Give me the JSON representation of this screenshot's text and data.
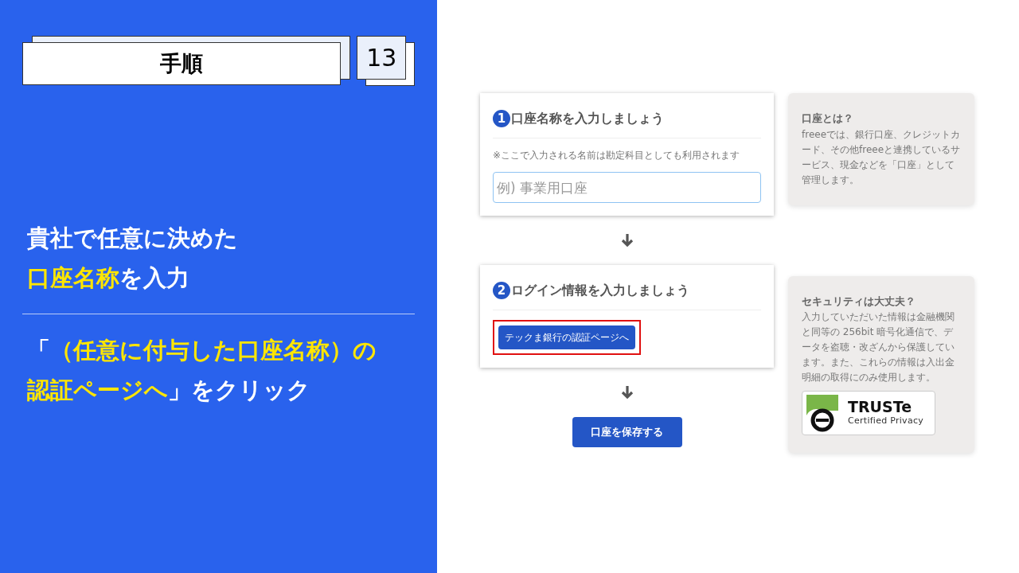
{
  "header": {
    "title": "手順",
    "step": "13"
  },
  "headline": [
    [
      {
        "text": "貴社で任意に決めた",
        "highlight": false
      }
    ],
    [
      {
        "text": "口座名称",
        "highlight": true
      },
      {
        "text": "を入力",
        "highlight": false
      }
    ]
  ],
  "instruction": [
    [
      {
        "text": "「",
        "highlight": false
      },
      {
        "text": "（任意に付与した口座名称）の",
        "highlight": true
      }
    ],
    [
      {
        "text": "認証ページへ",
        "highlight": true
      },
      {
        "text": "」をクリック",
        "highlight": false
      }
    ]
  ],
  "screen": {
    "steps": [
      {
        "number": "1",
        "title": "口座名称を入力しましょう",
        "kind": "input",
        "note": "※ここで入力される名前は勘定科目としても利用されます",
        "placeholder": "例) 事業用口座"
      },
      {
        "number": "2",
        "title": "ログイン情報を入力しましょう",
        "kind": "button",
        "button": "テックま銀行の認証ページへ",
        "highlighted": true
      }
    ],
    "save_button": "口座を保存する",
    "tips": [
      {
        "title": "口座とは？",
        "body": "freeeでは、銀行口座、クレジットカード、その他freeeと連携しているサービス、現金などを「口座」として管理します。"
      },
      {
        "title": "セキュリティは大丈夫？",
        "body": "入力していただいた情報は金融機関と同等の 256bit 暗号化通信で、データを盗聴・改ざんから保護しています。また、これらの情報は入出金明細の取得にのみ使用します。",
        "badge": {
          "name": "TRUSTe",
          "caption": "Certified Privacy"
        }
      }
    ]
  }
}
